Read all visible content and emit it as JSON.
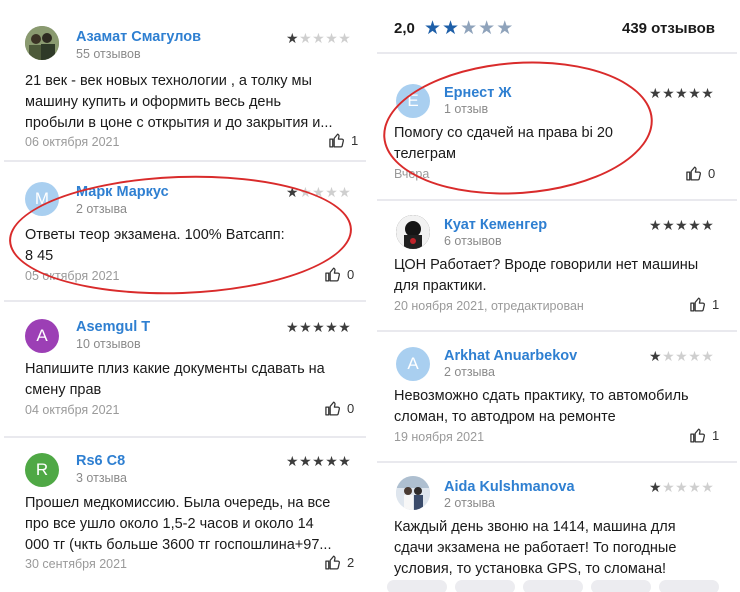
{
  "left_reviews": [
    {
      "name": "Азамат Смагулов",
      "count": "55 отзывов",
      "stars": 1,
      "text": [
        "21 век - век новых технологии , а толку мы",
        "машину купить и оформить весь день",
        "пробыли в цоне с открытия и до закрытия и..."
      ],
      "date": "06 октября 2021",
      "likes": "1",
      "avatar_letter": "",
      "avatar_color": "#6a7b55"
    },
    {
      "name": "Марк Маркус",
      "count": "2 отзыва",
      "stars": 1,
      "text": [
        "Ответы теор экзамена.  100%  Ватсапп:",
        "8          45"
      ],
      "date": "05 октября 2021",
      "likes": "0",
      "avatar_letter": "М",
      "avatar_color": "#a9cff0"
    },
    {
      "name": "Asemgul T",
      "count": "10 отзывов",
      "stars": 5,
      "text": [
        "Напишите плиз какие документы сдавать на",
        "смену прав"
      ],
      "date": "04 октября 2021",
      "likes": "0",
      "avatar_letter": "A",
      "avatar_color": "#9c3fb5"
    },
    {
      "name": "Rs6 C8",
      "count": "3 отзыва",
      "stars": 5,
      "text": [
        "Прошел медкомиссию. Была очередь, на все",
        "про все ушло около 1,5-2 часов и около 14",
        "000 тг (чкть больше 3600 тг госпошлина+97..."
      ],
      "date": "30 сентября 2021",
      "likes": "2",
      "avatar_letter": "R",
      "avatar_color": "#4fa845"
    }
  ],
  "rating_summary": {
    "average": "2,0",
    "stars": 2,
    "total": "439 отзывов"
  },
  "right_reviews": [
    {
      "name": "Ернест Ж",
      "count": "1 отзыв",
      "stars": 5,
      "text": [
        "Помогу со сдачей на права bi     20",
        "телеграм"
      ],
      "date": "Вчера",
      "likes": "0",
      "avatar_letter": "Е",
      "avatar_color": "#a9cff0"
    },
    {
      "name": "Куат Кеменгер",
      "count": "6 отзывов",
      "stars": 5,
      "text": [
        "ЦОН Работает? Вроде говорили нет машины",
        "для практики."
      ],
      "date": "20 ноября 2021, отредактирован",
      "likes": "1",
      "avatar_letter": "",
      "avatar_color": "#1b1b1b"
    },
    {
      "name": "Arkhat Anuarbekov",
      "count": "2 отзыва",
      "stars": 1,
      "text": [
        "Невозможно сдать практику, то автомобиль",
        "сломан, то автодром на ремонте"
      ],
      "date": "19 ноября 2021",
      "likes": "1",
      "avatar_letter": "A",
      "avatar_color": "#a9cff0"
    },
    {
      "name": "Aida Kulshmanova",
      "count": "2 отзыва",
      "stars": 1,
      "text": [
        "Каждый день звоню на 1414, машина для",
        "сдачи экзамена не работает! То погодные",
        "условия, то установка GPS, то сломана!"
      ],
      "date": "",
      "likes": "",
      "avatar_letter": "",
      "avatar_color": "#c9d7e3"
    }
  ],
  "colors": {
    "accent": "#2e7fd1",
    "annotation": "#d92b2b",
    "rating_star": "#1e5fa8"
  },
  "icons": {
    "like": "thumbs-up-icon",
    "star": "star-icon"
  }
}
